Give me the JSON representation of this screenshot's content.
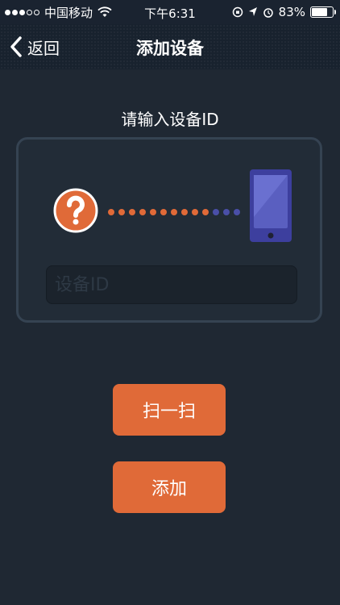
{
  "status_bar": {
    "carrier": "中国移动",
    "time": "下午6:31",
    "battery": "83%",
    "battery_level": 0.83
  },
  "nav": {
    "back_label": "返回",
    "title": "添加设备"
  },
  "main": {
    "prompt": "请输入设备ID",
    "device_id_placeholder": "设备ID",
    "device_id_value": ""
  },
  "buttons": {
    "scan_label": "扫一扫",
    "add_label": "添加"
  },
  "colors": {
    "background": "#1f2833",
    "accent": "#e06a38",
    "phone": "#3d3f9e",
    "link_dot_active": "#e06a38",
    "link_dot_inactive": "#4a4fa8"
  },
  "icons": {
    "back": "chevron-left-icon",
    "question": "question-mark-icon",
    "phone": "phone-icon",
    "wifi": "wifi-icon",
    "battery": "battery-icon"
  },
  "link_indicator": {
    "active_dots": 10,
    "inactive_dots": 3
  }
}
